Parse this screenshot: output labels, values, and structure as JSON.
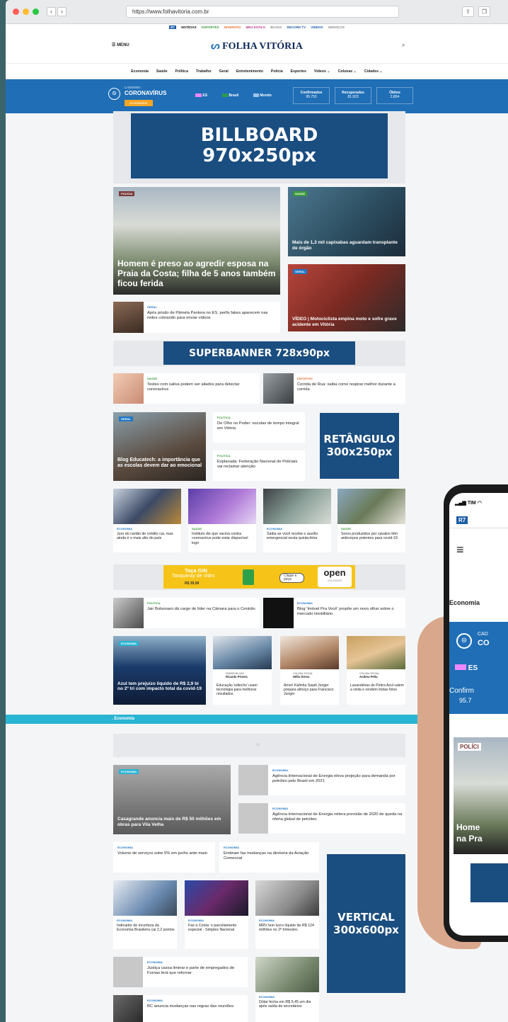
{
  "browser": {
    "url": "https://www.folhavitoria.com.br"
  },
  "topbar": {
    "items": [
      "R7",
      "NOTÍCIAS",
      "ESPORTES",
      "DIVERSÃO",
      "MEU ESTILO",
      "BLOGS",
      "RECORD TV",
      "VÍDEOS",
      "SERVIÇOS"
    ]
  },
  "header": {
    "menu": "MENU",
    "logo": "FOLHA VITÓRIA"
  },
  "nav": [
    "Economia",
    "Saúde",
    "Política",
    "Trabalho",
    "Geral",
    "Entretenimento",
    "Polícia",
    "Esportes",
    "Vídeos ⌄",
    "Colunas ⌄",
    "Cidades ⌄"
  ],
  "covid": {
    "caderno": "CADERNO",
    "title": "CORONAVÍRUS",
    "acomp": "Acompanhar",
    "regions": [
      "ES",
      "Brasil",
      "Mundo"
    ],
    "stats": [
      {
        "label": "Confirmados",
        "value": "95.753"
      },
      {
        "label": "Recuperados",
        "value": "81.923"
      },
      {
        "label": "Óbitos",
        "value": "2.804"
      }
    ]
  },
  "ads": {
    "billboard": "BILLBOARD\n970x250px",
    "superbanner": "SUPERBANNER 728x90px",
    "retangulo": "RETÂNGULO\n300x250px",
    "vertical": "VERTICAL\n300x600px",
    "taca": {
      "title": "Taça GIN",
      "sub": "Tanqueray de Vidro",
      "price": "R$ 39,99",
      "cta": "Clique e peça",
      "brand": "open",
      "brand_sub": "UTILIDADES"
    }
  },
  "news": {
    "main": {
      "tag": "POLÍCIA",
      "title": "Homem é preso ao agredir esposa na Praia da Costa; filha de 5 anos também ficou ferida"
    },
    "side1": {
      "tag": "SAÚDE",
      "title": "Mais de 1,3 mil capixabas aguardam transplante de órgão"
    },
    "side2": {
      "tag": "GERAL",
      "title": "VÍDEO | Motociclista empina moto e sofre grave acidente em Vitória"
    },
    "small1": {
      "tag": "GERAL",
      "title": "Após prisão de Pâmela Pantera no ES, perfis fakes aparecem nas redes cobrando para enviar vídeos"
    },
    "row1": [
      {
        "tag": "SAÚDE",
        "title": "Testes com saliva podem ser aliados para detectar coronavírus"
      },
      {
        "tag": "ESPORTES",
        "title": "Corrida de Rua: saiba como respirar melhor durante a corrida"
      }
    ],
    "blog": {
      "tag": "GERAL",
      "title": "Blog Educatech: a importância que as escolas devem dar ao emocional"
    },
    "pol1": {
      "tag": "POLÍTICA",
      "title": "De Olho no Poder: escolas de tempo integral em Vitória"
    },
    "pol2": {
      "tag": "POLÍTICA",
      "title": "Esplanada: Federação Nacional de Policiais vai reclamar atenção"
    },
    "row4": [
      {
        "tag": "ECONOMIA",
        "title": "Juro do cartão de crédito cai, mas ainda é o mais alto do país"
      },
      {
        "tag": "SAÚDE",
        "title": "Instituto diz que vacina contra coronavírus pode estar disponível logo"
      },
      {
        "tag": "ECONOMIA",
        "title": "Saiba se você recebe o auxílio emergencial nesta quinta-feira"
      },
      {
        "tag": "SAÚDE",
        "title": "Soros produzidos por cavalos têm anticorpos potentes para covid-19"
      }
    ],
    "row5": [
      {
        "tag": "POLÍTICA",
        "title": "Jair Bolsonaro dá cargo de líder na Câmara para o Centrão"
      },
      {
        "tag": "ECONOMIA",
        "title": "Blog 'Imóvel Pra Você' propõe um novo olhar sobre o mercado imobiliário"
      }
    ],
    "azul": {
      "tag": "ECONOMIA",
      "title": "Azul tem prejuízo líquido de R$ 2,9 bi no 2º tri com impacto total da covid-19"
    },
    "cols": [
      {
        "k": "HUMOR BLOGS",
        "a": "Ricardo Prizera",
        "title": "Educação 'edtechs' usam tecnologia para melhorar resultados"
      },
      {
        "k": "COLUNA SOCIAL",
        "a": "Hélio Dórea",
        "title": "Amor! Kafinha Saadi Junger prepara almoço para Francisco Junger"
      },
      {
        "k": "COLUNA SOCIAL",
        "a": "Andrea Peña",
        "title": "Lavandérias de Pedra Azul valem a visita e rendem lindas fotos"
      }
    ]
  },
  "economia": {
    "label": ". Economia",
    "main": {
      "tag": "ECONOMIA",
      "title": "Casagrande anuncia mais de R$ 50 milhões em obras para Vila Velha"
    },
    "side": [
      {
        "tag": "ECONOMIA",
        "title": "Agência Internacional de Energia eleva projeção para demanda por petróleo pelo Brasil em 2021"
      },
      {
        "tag": "ECONOMIA",
        "title": "Agência Internacional de Energia reitera previsão de 2020 de queda na oferta global de petróleo"
      }
    ],
    "mid": [
      {
        "tag": "ECONOMIA",
        "title": "Volume de serviços sobe 5% em junho ante maio"
      },
      {
        "tag": "ECONOMIA",
        "title": "Embraer faz mudanças na diretoria da Aviação Comercial"
      }
    ],
    "grid": [
      {
        "tag": "ECONOMIA",
        "title": "Indicador de Incerteza da Economia Brasileira cai 2,2 pontos"
      },
      {
        "tag": "ECONOMIA",
        "title": "Faz a Conta: o parcelamento especial - Simples Nacional"
      },
      {
        "tag": "ECONOMIA",
        "title": "MRV tem lucro líquido de R$ 124 milhões no 2º trimestre,"
      }
    ],
    "list": [
      {
        "tag": "ECONOMIA",
        "title": "Justiça cassa liminar e parte de empregados de Furnas terá que retornar"
      },
      {
        "tag": "ECONOMIA",
        "title": "BC anuncia mudanças nas regras das reuniões"
      },
      {
        "tag": "ECONOMIA",
        "title": "Dólar fecha em R$ 5,45 um dia após saída de secretários"
      }
    ]
  },
  "phone": {
    "carrier": "TIM",
    "r7": "R7",
    "nav": "Economia",
    "cad": "CAD",
    "co": "CO",
    "es": "ES",
    "confirm": "Confirm",
    "val": "95.7",
    "tag": "POLÍCI",
    "h1": "Home",
    "h2": "na Pra"
  }
}
